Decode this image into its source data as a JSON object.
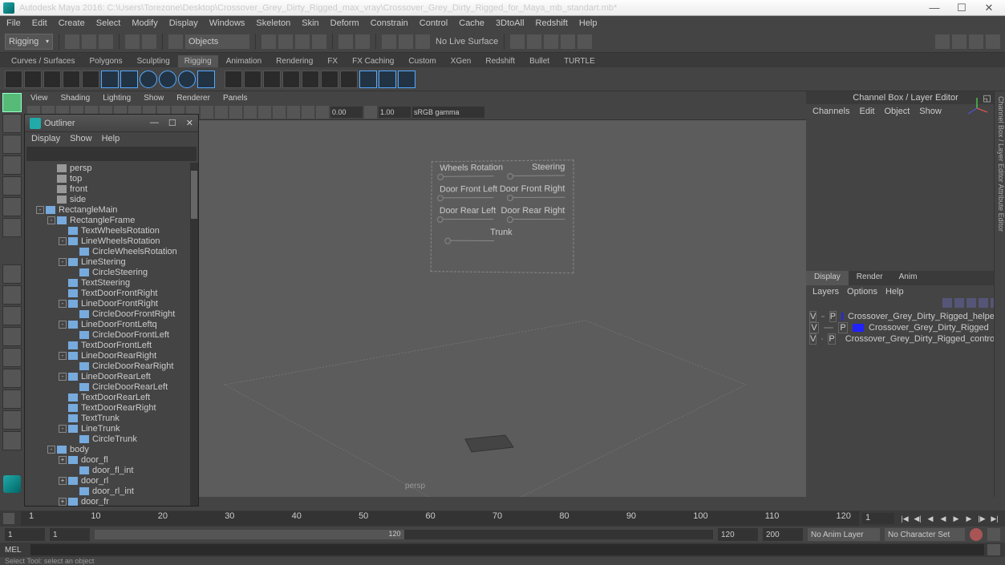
{
  "app_title": "Autodesk Maya 2016: C:\\Users\\Torezone\\Desktop\\Crossover_Grey_Dirty_Rigged_max_vray\\Crossover_Grey_Dirty_Rigged_for_Maya_mb_standart.mb*",
  "menu": [
    "File",
    "Edit",
    "Create",
    "Select",
    "Modify",
    "Display",
    "Windows",
    "Skeleton",
    "Skin",
    "Deform",
    "Constrain",
    "Control",
    "Cache",
    "3DtoAll",
    "Redshift",
    "Help"
  ],
  "mode_dropdown": "Rigging",
  "search_dropdown": "Objects",
  "no_live_surface": "No Live Surface",
  "shelves": [
    "Curves / Surfaces",
    "Polygons",
    "Sculpting",
    "Rigging",
    "Animation",
    "Rendering",
    "FX",
    "FX Caching",
    "Custom",
    "XGen",
    "Redshift",
    "Bullet",
    "TURTLE"
  ],
  "active_shelf": "Rigging",
  "panel_menus": [
    "View",
    "Shading",
    "Lighting",
    "Show",
    "Renderer",
    "Panels"
  ],
  "panel_fields": {
    "a": "0.00",
    "b": "1.00"
  },
  "color_mgmt": "sRGB gamma",
  "persp_label": "persp",
  "rig_labels": {
    "wheels_rot": "Wheels Rotation",
    "steering": "Steering",
    "dfl": "Door Front Left",
    "dfr": "Door Front Right",
    "drl": "Door Rear Left",
    "drr": "Door Rear Right",
    "trunk": "Trunk"
  },
  "outliner": {
    "title": "Outliner",
    "menu": [
      "Display",
      "Show",
      "Help"
    ],
    "items": [
      {
        "d": 1,
        "t": "",
        "i": "cam",
        "l": "persp"
      },
      {
        "d": 1,
        "t": "",
        "i": "cam",
        "l": "top"
      },
      {
        "d": 1,
        "t": "",
        "i": "cam",
        "l": "front"
      },
      {
        "d": 1,
        "t": "",
        "i": "cam",
        "l": "side"
      },
      {
        "d": 0,
        "t": "-",
        "i": "crv",
        "l": "RectangleMain"
      },
      {
        "d": 1,
        "t": "-",
        "i": "crv",
        "l": "RectangleFrame"
      },
      {
        "d": 2,
        "t": "",
        "i": "crv",
        "l": "TextWheelsRotation"
      },
      {
        "d": 2,
        "t": "-",
        "i": "crv",
        "l": "LineWheelsRotation"
      },
      {
        "d": 3,
        "t": "",
        "i": "crv",
        "l": "CircleWheelsRotation"
      },
      {
        "d": 2,
        "t": "-",
        "i": "crv",
        "l": "LineStering"
      },
      {
        "d": 3,
        "t": "",
        "i": "crv",
        "l": "CircleSteering"
      },
      {
        "d": 2,
        "t": "",
        "i": "crv",
        "l": "TextSteering"
      },
      {
        "d": 2,
        "t": "",
        "i": "crv",
        "l": "TextDoorFrontRight"
      },
      {
        "d": 2,
        "t": "-",
        "i": "crv",
        "l": "LineDoorFrontRight"
      },
      {
        "d": 3,
        "t": "",
        "i": "crv",
        "l": "CircleDoorFrontRight"
      },
      {
        "d": 2,
        "t": "-",
        "i": "crv",
        "l": "LineDoorFrontLeftq"
      },
      {
        "d": 3,
        "t": "",
        "i": "crv",
        "l": "CircleDoorFrontLeft"
      },
      {
        "d": 2,
        "t": "",
        "i": "crv",
        "l": "TextDoorFrontLeft"
      },
      {
        "d": 2,
        "t": "-",
        "i": "crv",
        "l": "LineDoorRearRight"
      },
      {
        "d": 3,
        "t": "",
        "i": "crv",
        "l": "CircleDoorRearRight"
      },
      {
        "d": 2,
        "t": "-",
        "i": "crv",
        "l": "LineDoorRearLeft"
      },
      {
        "d": 3,
        "t": "",
        "i": "crv",
        "l": "CircleDoorRearLeft"
      },
      {
        "d": 2,
        "t": "",
        "i": "crv",
        "l": "TextDoorRearLeft"
      },
      {
        "d": 2,
        "t": "",
        "i": "crv",
        "l": "TextDoorRearRight"
      },
      {
        "d": 2,
        "t": "",
        "i": "crv",
        "l": "TextTrunk"
      },
      {
        "d": 2,
        "t": "-",
        "i": "crv",
        "l": "LineTrunk"
      },
      {
        "d": 3,
        "t": "",
        "i": "crv",
        "l": "CircleTrunk"
      },
      {
        "d": 1,
        "t": "-",
        "i": "crv",
        "l": "body"
      },
      {
        "d": 2,
        "t": "+",
        "i": "crv",
        "l": "door_fl"
      },
      {
        "d": 3,
        "t": "",
        "i": "crv",
        "l": "door_fl_int"
      },
      {
        "d": 2,
        "t": "+",
        "i": "crv",
        "l": "door_rl"
      },
      {
        "d": 3,
        "t": "",
        "i": "crv",
        "l": "door_rl_int"
      },
      {
        "d": 2,
        "t": "+",
        "i": "crv",
        "l": "door_fr"
      }
    ]
  },
  "channel_box": {
    "title": "Channel Box / Layer Editor",
    "tabs": [
      "Channels",
      "Edit",
      "Object",
      "Show"
    ]
  },
  "layer_tabs": [
    "Display",
    "Render",
    "Anim"
  ],
  "layer_menu": [
    "Layers",
    "Options",
    "Help"
  ],
  "layers": [
    {
      "v": "V",
      "p": "P",
      "c": "#22f",
      "n": "Crossover_Grey_Dirty_Rigged_helpers"
    },
    {
      "v": "V",
      "p": "P",
      "c": "#22f",
      "n": "Crossover_Grey_Dirty_Rigged"
    },
    {
      "v": "V",
      "p": "P",
      "c": "#f22",
      "n": "Crossover_Grey_Dirty_Rigged_controllers"
    }
  ],
  "timeline": {
    "ticks": [
      "1",
      "10",
      "20",
      "30",
      "40",
      "50",
      "60",
      "70",
      "80",
      "90",
      "100",
      "110",
      "120"
    ],
    "start": "1",
    "r_start": "1",
    "r_cur": "120",
    "r_end": "120",
    "end": "200",
    "anim_layer": "No Anim Layer",
    "char_set": "No Character Set"
  },
  "cmd_label": "MEL",
  "help_line": "Select Tool: select an object",
  "side_tabs": "Channel Box / Layer Editor    Attribute Editor"
}
